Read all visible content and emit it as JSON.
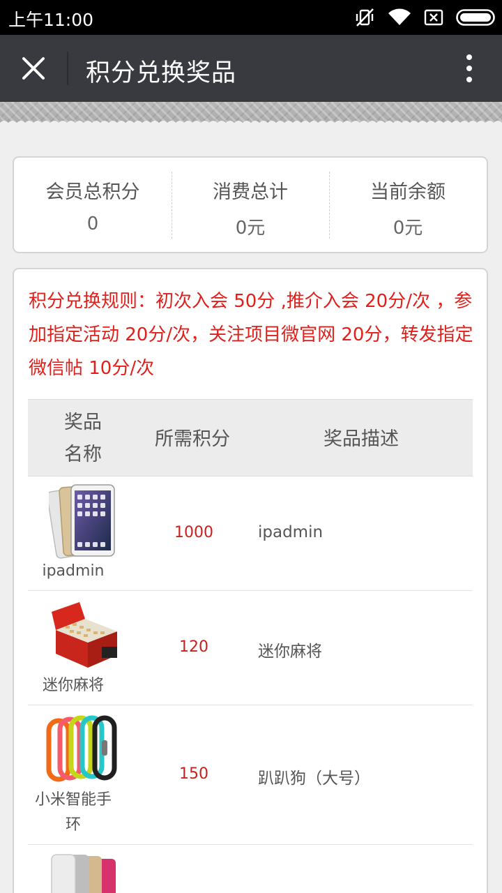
{
  "status_bar": {
    "time": "上午11:00"
  },
  "nav": {
    "title": "积分兑换奖品"
  },
  "stats": [
    {
      "label": "会员总积分",
      "value": "0"
    },
    {
      "label": "消费总计",
      "value": "0元"
    },
    {
      "label": "当前余额",
      "value": "0元"
    }
  ],
  "rules": "积分兑换规则：初次入会 50分 ,推介入会 20分/次 ，参加指定活动 20分/次，关注项目微官网 20分，转发指定微信帖 10分/次",
  "table": {
    "headers": {
      "name": "奖品名称",
      "points": "所需积分",
      "desc": "奖品描述"
    },
    "rows": [
      {
        "name": "ipadmin",
        "points": "1000",
        "desc": "ipadmin",
        "icon": "tablet-icon"
      },
      {
        "name": "迷你麻将",
        "points": "120",
        "desc": "迷你麻将",
        "icon": "mahjong-box-icon"
      },
      {
        "name": "小米智能手环",
        "points": "150",
        "desc": "趴趴狗（大号）",
        "icon": "wristband-icon"
      },
      {
        "name": "",
        "points": "",
        "desc": "",
        "icon": "power-bank-icon"
      }
    ]
  },
  "colors": {
    "navbar": "#393a3f",
    "accent_red": "#e0201a",
    "points_red": "#c9211d",
    "background": "#efefef"
  }
}
